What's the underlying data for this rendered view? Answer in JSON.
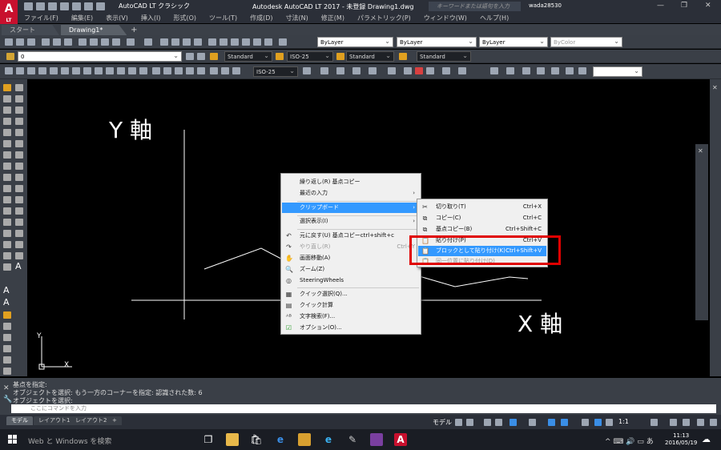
{
  "app": {
    "logo_text": "A",
    "logo_sub": "LT",
    "workspace": "AutoCAD LT クラシック",
    "title": "Autodesk AutoCAD LT 2017 - 未登録   Drawing1.dwg",
    "search_placeholder": "キーワードまたは語句を入力",
    "username": "wada28530"
  },
  "menubar": [
    "ファイル(F)",
    "編集(E)",
    "表示(V)",
    "挿入(I)",
    "形式(O)",
    "ツール(T)",
    "作成(D)",
    "寸法(N)",
    "修正(M)",
    "パラメトリック(P)",
    "ウィンドウ(W)",
    "ヘルプ(H)"
  ],
  "tabs": {
    "start": "スタート",
    "drawing": "Drawing1*",
    "add": "+"
  },
  "toolbar2": {
    "layer": "ByLayer",
    "linetype": "ByLayer",
    "lineweight": "ByLayer",
    "color": "ByColor"
  },
  "toolbar3": {
    "layer_name": "0",
    "text_style": "Standard",
    "dim_style": "ISO-25",
    "table_style": "Standard",
    "mleader_style": "Standard"
  },
  "toolbar4": {
    "dim_style": "ISO-25"
  },
  "canvas": {
    "y_axis_label": "Y 軸",
    "x_axis_label": "X 軸",
    "ucs_y": "Y",
    "ucs_x": "X"
  },
  "context_menu": [
    {
      "label": "繰り返し(R) 基点コピー",
      "shortcut": "",
      "submenu": false,
      "icon": ""
    },
    {
      "label": "最近の入力",
      "shortcut": "",
      "submenu": true,
      "icon": ""
    },
    {
      "label": "クリップボード",
      "shortcut": "",
      "submenu": true,
      "icon": "",
      "highlighted": true
    },
    {
      "label": "選択表示(I)",
      "shortcut": "",
      "submenu": true,
      "icon": ""
    },
    {
      "label": "元に戻す(U) 基点コピーctrl+shift+c",
      "shortcut": "",
      "submenu": false,
      "icon": "↶"
    },
    {
      "label": "やり直し(R)",
      "shortcut": "Ctrl+Y",
      "submenu": false,
      "icon": "↷",
      "disabled": true
    },
    {
      "label": "画面移動(A)",
      "shortcut": "",
      "submenu": false,
      "icon": "✋"
    },
    {
      "label": "ズーム(Z)",
      "shortcut": "",
      "submenu": false,
      "icon": "🔍"
    },
    {
      "label": "SteeringWheels",
      "shortcut": "",
      "submenu": false,
      "icon": "◎"
    },
    {
      "label": "クイック選択(Q)...",
      "shortcut": "",
      "submenu": false,
      "icon": "▦"
    },
    {
      "label": "クイック計算",
      "shortcut": "",
      "submenu": false,
      "icon": "▤"
    },
    {
      "label": "文字検索(F)...",
      "shortcut": "",
      "submenu": false,
      "icon": "ᴬᴮ"
    },
    {
      "label": "オプション(O)...",
      "shortcut": "",
      "submenu": false,
      "icon": "☑"
    }
  ],
  "clipboard_menu": [
    {
      "label": "切り取り(T)",
      "shortcut": "Ctrl+X",
      "icon": "✂"
    },
    {
      "label": "コピー(C)",
      "shortcut": "Ctrl+C",
      "icon": "⧉"
    },
    {
      "label": "基点コピー(B)",
      "shortcut": "Ctrl+Shift+C",
      "icon": "⧉"
    },
    {
      "label": "貼り付け(P)",
      "shortcut": "Ctrl+V",
      "icon": "📋"
    },
    {
      "label": "ブロックとして貼り付け(K)",
      "shortcut": "Ctrl+Shift+V",
      "icon": "📋",
      "highlighted": true
    },
    {
      "label": "同一位置に貼り付け(D)",
      "shortcut": "",
      "icon": "📋",
      "disabled": true
    }
  ],
  "command": {
    "history": [
      "基点を指定:",
      "オブジェクトを選択: もう一方のコーナーを指定: 認識された数: 6",
      "オブジェクトを選択:"
    ],
    "placeholder": "ここにコマンドを入力"
  },
  "layout_tabs": [
    "モデル",
    "レイアウト1",
    "レイアウト2",
    "+"
  ],
  "status": {
    "model": "モデル",
    "scale": "1:1"
  },
  "taskbar": {
    "search": "Web と Windows を検索",
    "time": "11:13",
    "date": "2016/05/19",
    "ime": "あ"
  },
  "colors": {
    "accent_red": "#e00000",
    "highlight_blue": "#3399ff",
    "logo_red": "#c8102e"
  }
}
